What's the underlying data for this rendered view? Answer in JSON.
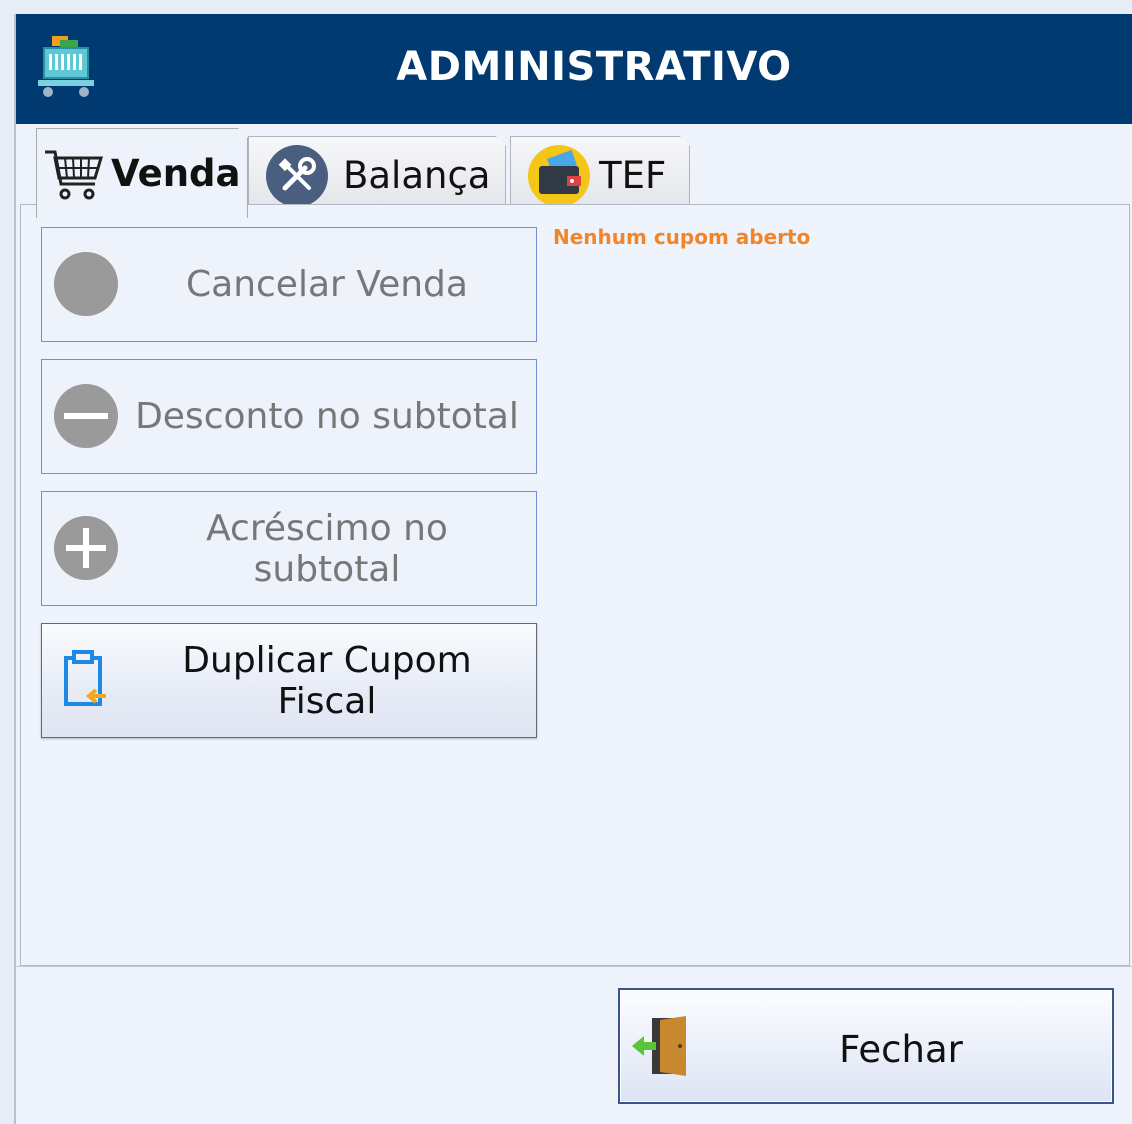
{
  "window": {
    "title": "ADMINISTRATIVO"
  },
  "tabs": [
    {
      "label": "Venda",
      "icon": "shopping-cart-icon",
      "active": true
    },
    {
      "label": "Balança",
      "icon": "tools-icon",
      "active": false
    },
    {
      "label": "TEF",
      "icon": "wallet-icon",
      "active": false
    }
  ],
  "venda": {
    "status_message": "Nenhum cupom aberto",
    "buttons": [
      {
        "label": "Cancelar Venda",
        "icon": "circle-icon",
        "enabled": false
      },
      {
        "label": "Desconto no subtotal",
        "icon": "minus-circle-icon",
        "enabled": false
      },
      {
        "label": "Acréscimo no subtotal",
        "icon": "plus-circle-icon",
        "enabled": false
      },
      {
        "label": "Duplicar Cupom Fiscal",
        "icon": "clipboard-icon",
        "enabled": true
      }
    ]
  },
  "footer": {
    "close_label": "Fechar",
    "close_icon": "exit-door-icon"
  },
  "colors": {
    "titlebar": "#003a70",
    "status_text": "#f2852a",
    "disabled_icon": "#9a9a9a",
    "button_border": "#6f8fd6"
  }
}
